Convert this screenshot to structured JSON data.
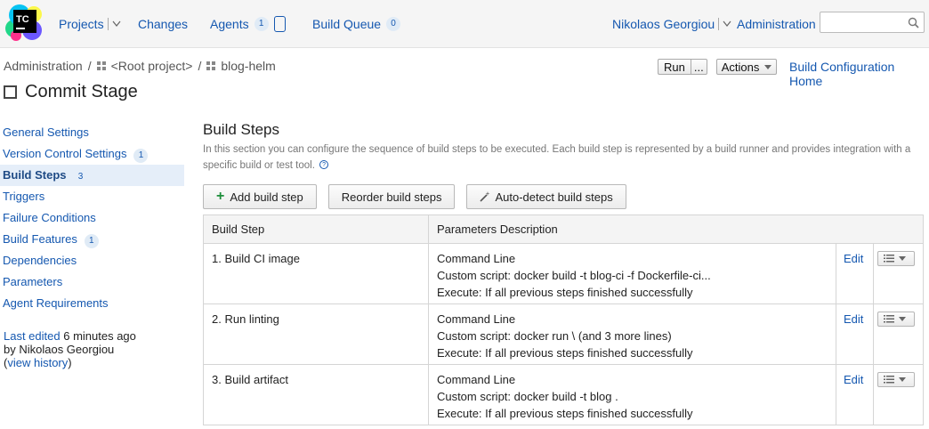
{
  "header": {
    "logo_text": "TC",
    "nav": {
      "projects": "Projects",
      "changes": "Changes",
      "agents": "Agents",
      "agents_count": "1",
      "build_queue": "Build Queue",
      "build_queue_count": "0",
      "user": "Nikolaos Georgiou",
      "administration": "Administration"
    },
    "search": {
      "value": "",
      "placeholder": ""
    }
  },
  "breadcrumb": {
    "items": [
      "Administration",
      "<Root project>",
      "blog-helm"
    ],
    "separator": "/"
  },
  "page_title": "Commit Stage",
  "top_actions": {
    "run": "Run",
    "run_more": "...",
    "actions": "Actions",
    "home_link": "Build Configuration Home"
  },
  "sidebar": {
    "items": [
      {
        "label": "General Settings",
        "count": ""
      },
      {
        "label": "Version Control Settings",
        "count": "1"
      },
      {
        "label": "Build Steps",
        "count": "3",
        "active": true
      },
      {
        "label": "Triggers",
        "count": ""
      },
      {
        "label": "Failure Conditions",
        "count": ""
      },
      {
        "label": "Build Features",
        "count": "1"
      },
      {
        "label": "Dependencies",
        "count": ""
      },
      {
        "label": "Parameters",
        "count": ""
      },
      {
        "label": "Agent Requirements",
        "count": ""
      }
    ],
    "last_edited_link": "Last edited",
    "last_edited_time": "6 minutes ago",
    "last_edited_by": "by Nikolaos Georgiou",
    "view_history": "view history"
  },
  "main": {
    "title": "Build Steps",
    "description": "In this section you can configure the sequence of build steps to be executed. Each build step is represented by a build runner and provides integration with a specific build or test tool.",
    "buttons": {
      "add": "Add build step",
      "reorder": "Reorder build steps",
      "autodetect": "Auto-detect build steps"
    },
    "table": {
      "headers": [
        "Build Step",
        "Parameters Description"
      ],
      "edit_label": "Edit",
      "rows": [
        {
          "step": "1. Build CI image",
          "runner": "Command Line",
          "script": "Custom script: docker build -t blog-ci -f Dockerfile-ci...",
          "execute": "Execute: If all previous steps finished successfully"
        },
        {
          "step": "2. Run linting",
          "runner": "Command Line",
          "script": "Custom script: docker run \\ (and 3 more lines)",
          "execute": "Execute: If all previous steps finished successfully"
        },
        {
          "step": "3. Build artifact",
          "runner": "Command Line",
          "script": "Custom script: docker build -t blog .",
          "execute": "Execute: If all previous steps finished successfully"
        }
      ]
    }
  },
  "colors": {
    "link": "#1558b0",
    "header_bg": "#f5f5f5",
    "active_bg": "#e5eef9",
    "add_plus": "#1d8e3b"
  },
  "icons": [
    "teamcity-logo-icon",
    "caret-down-icon",
    "agent-icon",
    "search-icon",
    "project-grid-icon",
    "help-icon",
    "plus-icon",
    "wand-icon",
    "list-menu-icon"
  ]
}
